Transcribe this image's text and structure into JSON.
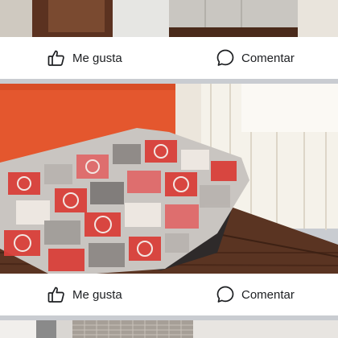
{
  "posts": [
    {
      "actions": {
        "like_label": "Me gusta",
        "comment_label": "Comentar"
      }
    },
    {
      "actions": {
        "like_label": "Me gusta",
        "comment_label": "Comentar"
      }
    }
  ],
  "icons": {
    "like": "thumbs-up-icon",
    "comment": "speech-bubble-icon"
  },
  "colors": {
    "wall": "#e4572e",
    "window_light": "#f5f2ea",
    "floor": "#5a3422",
    "bar_bg": "#ffffff",
    "feed_bg": "#c9ccd1",
    "text": "#1c1e21"
  }
}
